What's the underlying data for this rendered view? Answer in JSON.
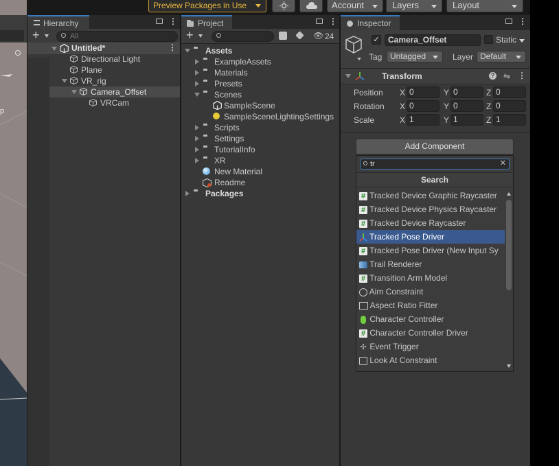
{
  "top_toolbar": {
    "preview_packages_label": "Preview Packages in Use",
    "account_label": "Account",
    "layers_label": "Layers",
    "layout_label": "Layout"
  },
  "hierarchy": {
    "tab_label": "Hierarchy",
    "search_placeholder": "All",
    "scene_name": "Untitled*",
    "items": [
      {
        "label": "Directional Light"
      },
      {
        "label": "Plane"
      },
      {
        "label": "VR_rig"
      },
      {
        "label": "Camera_Offset"
      },
      {
        "label": "VRCam"
      }
    ]
  },
  "project": {
    "tab_label": "Project",
    "hidden_count": "24",
    "assets_label": "Assets",
    "items": [
      {
        "label": "ExampleAssets"
      },
      {
        "label": "Materials"
      },
      {
        "label": "Presets"
      },
      {
        "label": "Scenes"
      },
      {
        "label": "SampleScene"
      },
      {
        "label": "SampleSceneLightingSettings"
      },
      {
        "label": "Scripts"
      },
      {
        "label": "Settings"
      },
      {
        "label": "TutorialInfo"
      },
      {
        "label": "XR"
      },
      {
        "label": "New Material"
      },
      {
        "label": "Readme"
      }
    ],
    "packages_label": "Packages"
  },
  "inspector": {
    "tab_label": "Inspector",
    "object_name": "Camera_Offset",
    "static_label": "Static",
    "tag_label": "Tag",
    "tag_value": "Untagged",
    "layer_label": "Layer",
    "layer_value": "Default",
    "transform": {
      "title": "Transform",
      "position_label": "Position",
      "rotation_label": "Rotation",
      "scale_label": "Scale",
      "x": "X",
      "y": "Y",
      "z": "Z",
      "position": [
        "0",
        "0",
        "0"
      ],
      "rotation": [
        "0",
        "0",
        "0"
      ],
      "scale": [
        "1",
        "1",
        "1"
      ]
    },
    "add_component_label": "Add Component",
    "search_value": "tr",
    "search_header": "Search",
    "results": [
      {
        "label": "Tracked Device Graphic Raycaster",
        "icon": "script-icon"
      },
      {
        "label": "Tracked Device Physics Raycaster",
        "icon": "script-icon"
      },
      {
        "label": "Tracked Device Raycaster",
        "icon": "script-icon"
      },
      {
        "label": "Tracked Pose Driver",
        "icon": "transform-icon"
      },
      {
        "label": "Tracked Pose Driver (New Input Sy",
        "icon": "script-icon"
      },
      {
        "label": "Trail Renderer",
        "icon": "trail-icon"
      },
      {
        "label": "Transition Arm Model",
        "icon": "script-icon"
      },
      {
        "label": "Aim Constraint",
        "icon": "constraint-icon"
      },
      {
        "label": "Aspect Ratio Fitter",
        "icon": "fitter-icon"
      },
      {
        "label": "Character Controller",
        "icon": "character-controller-icon"
      },
      {
        "label": "Character Controller Driver",
        "icon": "script-icon"
      },
      {
        "label": "Event Trigger",
        "icon": "event-trigger-icon"
      },
      {
        "label": "Look At Constraint",
        "icon": "constraint-icon"
      }
    ],
    "selected_index": 3
  },
  "colors": {
    "selection": "#3a5a8f",
    "accent": "#3a79bb",
    "preview_border": "#c79a2b"
  }
}
